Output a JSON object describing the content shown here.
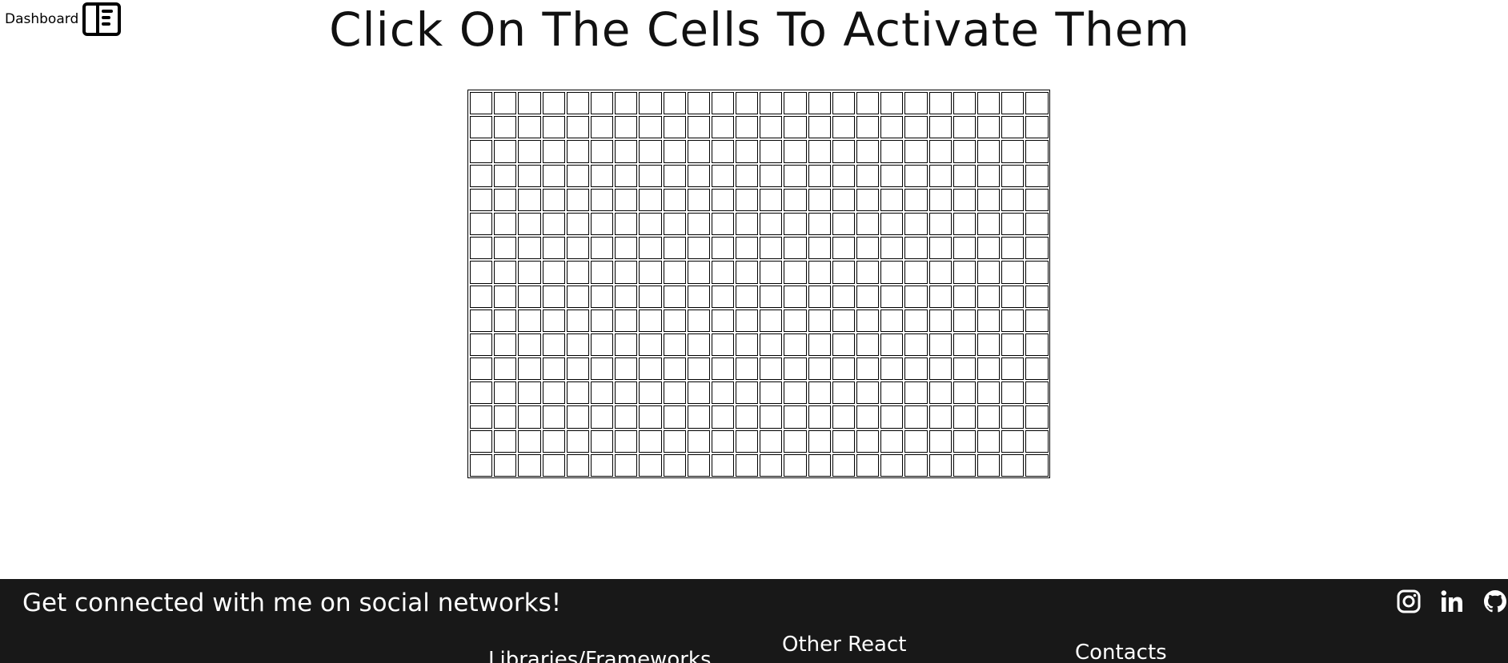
{
  "nav": {
    "dashboard_label": "Dashboard",
    "dashboard_icon": "sidebar-panel-icon"
  },
  "main": {
    "title": "Click On The Cells To Activate Them",
    "grid": {
      "columns": 24,
      "rows": 16,
      "active_cells": []
    }
  },
  "footer": {
    "heading": "Get connected with me on social networks!",
    "social": [
      {
        "name": "instagram",
        "icon": "instagram-icon"
      },
      {
        "name": "linkedin",
        "icon": "linkedin-icon"
      },
      {
        "name": "github",
        "icon": "github-icon"
      }
    ],
    "columns": {
      "libraries": "Libraries/Frameworks",
      "other_react": "Other React",
      "contacts": "Contacts"
    }
  },
  "colors": {
    "footer_bg": "#181818",
    "cell_border": "#000000",
    "active_cell": "#111111"
  }
}
